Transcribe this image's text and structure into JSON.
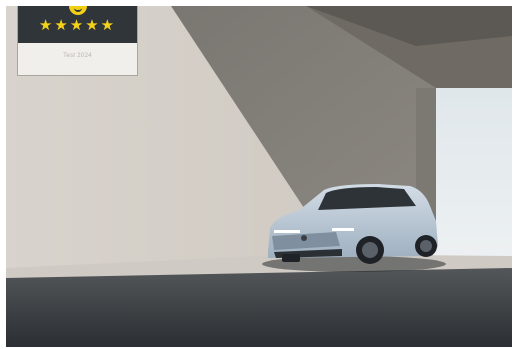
{
  "badge": {
    "rating_text": "★★★★★",
    "caption": "Test 2024",
    "icon": "rating-logo-icon",
    "star_icon": "star-icon",
    "accent_color": "#f4d21a",
    "panel_color": "#2f3538"
  },
  "scene": {
    "subject": "compact-electric-suv",
    "car_color": "#b9c9d8",
    "wall_color": "#d9d5cf",
    "floor_color": "#3c4044"
  }
}
